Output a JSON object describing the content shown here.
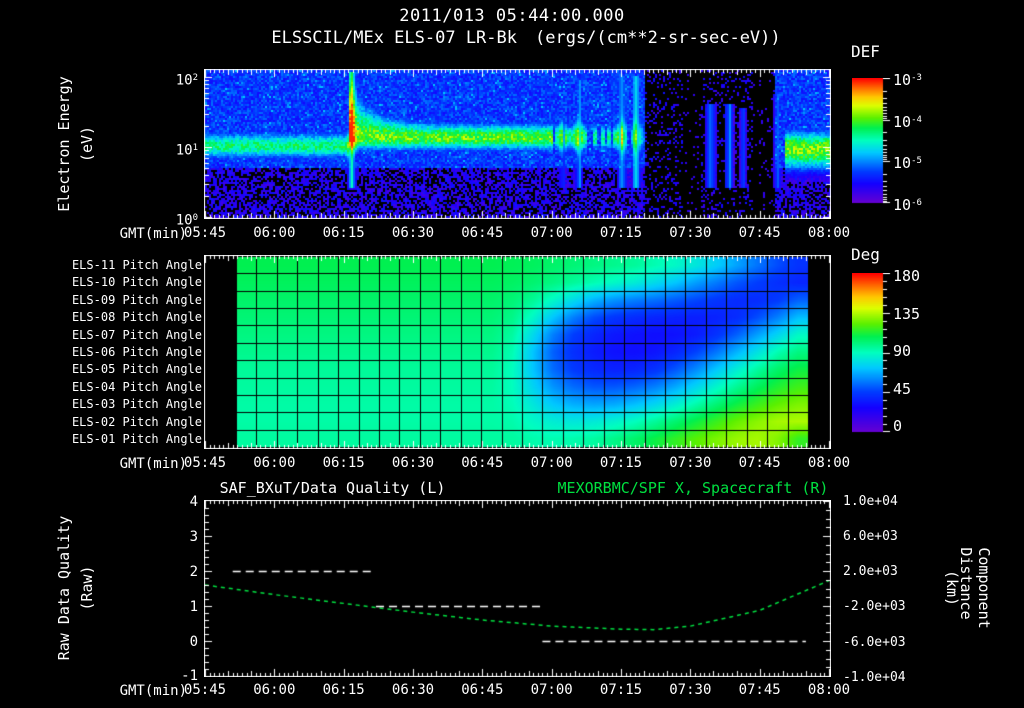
{
  "header": {
    "timestamp": "2011/013 05:44:00.000",
    "instrument_title": "ELSSCIL/MEx ELS-07 LR-Bk",
    "units": "(ergs/(cm**2-sr-sec-eV))"
  },
  "time_axis": {
    "label": "GMT(min)",
    "ticks": [
      "05:45",
      "06:00",
      "06:15",
      "06:30",
      "06:45",
      "07:00",
      "07:15",
      "07:30",
      "07:45",
      "08:00"
    ]
  },
  "spectrogram_panel": {
    "ylabel": "Electron Energy",
    "ylabel_units": "(eV)",
    "yticks": [
      {
        "base": "10",
        "exp": "2"
      },
      {
        "base": "10",
        "exp": "1"
      },
      {
        "base": "10",
        "exp": "0"
      }
    ],
    "colorbar": {
      "title": "DEF",
      "ticks": [
        {
          "base": "10",
          "exp": "-3"
        },
        {
          "base": "10",
          "exp": "-4"
        },
        {
          "base": "10",
          "exp": "-5"
        },
        {
          "base": "10",
          "exp": "-6"
        }
      ]
    }
  },
  "pitch_panel": {
    "row_labels": [
      "ELS-11 Pitch Angle",
      "ELS-10 Pitch Angle",
      "ELS-09 Pitch Angle",
      "ELS-08 Pitch Angle",
      "ELS-07 Pitch Angle",
      "ELS-06 Pitch Angle",
      "ELS-05 Pitch Angle",
      "ELS-04 Pitch Angle",
      "ELS-03 Pitch Angle",
      "ELS-02 Pitch Angle",
      "ELS-01 Pitch Angle"
    ],
    "colorbar": {
      "title": "Deg",
      "ticks": [
        "180",
        "135",
        "90",
        "45",
        "0"
      ]
    }
  },
  "quality_panel": {
    "title_left": "SAF_BXuT/Data Quality (L)",
    "title_right": "MEXORBMC/SPF X, Spacecraft (R)",
    "ylabel_left": "Raw Data Quality",
    "ylabel_left_units": "(Raw)",
    "ylabel_right": "Component Distance",
    "ylabel_right_units": "(km)",
    "yticks_left": [
      "4",
      "3",
      "2",
      "1",
      "0",
      "-1"
    ],
    "yticks_right": [
      "1.0e+04",
      "6.0e+03",
      "2.0e+03",
      "-2.0e+03",
      "-6.0e+03",
      "-1.0e+04"
    ]
  },
  "colors": {
    "text": "#ffffff",
    "accent_green": "#00e040",
    "background": "#000000"
  },
  "chart_data": [
    {
      "type": "heatmap",
      "title": "ELSSCIL/MEx ELS-07 LR-Bk electron differential energy flux spectrogram",
      "x_range_gmt": [
        "05:45",
        "08:00"
      ],
      "y_axis": {
        "label": "Electron Energy (eV)",
        "scale": "log",
        "range": [
          1,
          130
        ]
      },
      "z_axis": {
        "label": "DEF (ergs/(cm**2-sr-sec-eV))",
        "scale": "log",
        "range": [
          1e-06,
          0.001
        ]
      },
      "render": {
        "seed": 77,
        "band": {
          "center_log": 1.04,
          "sigma_up": 0.2,
          "sigma_dn": 0.18
        },
        "band_intensity": [
          [
            0,
            31,
            0.56
          ],
          [
            31,
            75,
            0.68
          ],
          [
            75,
            90,
            0.55
          ],
          [
            90,
            95,
            0.32
          ],
          [
            95,
            125,
            0
          ],
          [
            125,
            135.5,
            0.7
          ]
        ],
        "flare": {
          "t_min": 31,
          "decay": 5,
          "extra_sigma": 0.55
        },
        "post_flare_center": 1.16,
        "blob": {
          "t_min": 125,
          "center": 1.0,
          "sigma_up": 0.26,
          "sigma_dn": 0.3
        },
        "streaks": [
          [
            31.5,
            0.8,
            0.5,
            2.1
          ],
          [
            77,
            0.7,
            0.3,
            1.9
          ],
          [
            80.5,
            0.8,
            0.42,
            2.0
          ],
          [
            90,
            0.9,
            0.45,
            2.05
          ],
          [
            93,
            0.9,
            0.5,
            2.05
          ],
          [
            109,
            1.0,
            0.42,
            1.65
          ],
          [
            113,
            0.8,
            0.4,
            1.65
          ],
          [
            116,
            0.6,
            0.34,
            1.6
          ],
          [
            123.5,
            0.8,
            0.3,
            1.7
          ]
        ],
        "dark_zone": [
          95,
          123
        ],
        "black_columns": [
          [
            103,
            107
          ],
          [
            118,
            122.5
          ]
        ],
        "lower_split_log": 0.72
      }
    },
    {
      "type": "heatmap",
      "title": "ELS anode pitch angles",
      "units": "degrees",
      "rows": [
        "ELS-11",
        "ELS-10",
        "ELS-09",
        "ELS-08",
        "ELS-07",
        "ELS-06",
        "ELS-05",
        "ELS-04",
        "ELS-03",
        "ELS-02",
        "ELS-01"
      ],
      "col_start_gmt": "05:52",
      "col_end_gmt": "07:56",
      "n_cols": 28,
      "z_range": [
        0,
        180
      ],
      "values": [
        [
          108,
          108,
          108,
          108,
          108,
          108,
          108,
          108,
          108,
          108,
          108,
          108,
          108,
          107,
          106,
          104,
          102,
          100,
          98,
          96,
          92,
          88,
          82,
          74,
          65,
          56,
          48,
          42
        ],
        [
          106,
          106,
          106,
          106,
          106,
          106,
          106,
          106,
          106,
          106,
          106,
          106,
          106,
          105,
          103,
          100,
          96,
          92,
          88,
          84,
          78,
          72,
          64,
          57,
          50,
          45,
          41,
          38
        ],
        [
          104,
          104,
          104,
          104,
          104,
          104,
          104,
          104,
          104,
          104,
          104,
          104,
          104,
          102,
          97,
          88,
          78,
          68,
          62,
          58,
          55,
          51,
          47,
          43,
          40,
          40,
          44,
          52
        ],
        [
          102,
          102,
          102,
          102,
          102,
          102,
          102,
          102,
          102,
          102,
          102,
          102,
          102,
          99,
          88,
          72,
          58,
          48,
          43,
          40,
          38,
          37,
          36,
          37,
          40,
          48,
          58,
          70
        ],
        [
          100,
          100,
          100,
          100,
          100,
          100,
          100,
          100,
          100,
          100,
          100,
          100,
          100,
          95,
          78,
          58,
          45,
          38,
          34,
          32,
          31,
          32,
          35,
          42,
          52,
          64,
          76,
          88
        ],
        [
          98,
          98,
          98,
          98,
          98,
          98,
          98,
          98,
          98,
          98,
          98,
          98,
          98,
          92,
          72,
          52,
          41,
          35,
          32,
          31,
          33,
          38,
          46,
          56,
          68,
          80,
          92,
          100
        ],
        [
          96,
          96,
          96,
          96,
          96,
          96,
          96,
          96,
          96,
          96,
          96,
          96,
          96,
          90,
          72,
          54,
          44,
          39,
          37,
          38,
          42,
          50,
          60,
          72,
          84,
          95,
          104,
          110
        ],
        [
          95,
          95,
          95,
          95,
          95,
          95,
          95,
          95,
          95,
          95,
          95,
          95,
          95,
          90,
          76,
          62,
          54,
          50,
          50,
          53,
          58,
          66,
          76,
          87,
          97,
          106,
          113,
          118
        ],
        [
          94,
          94,
          94,
          94,
          94,
          94,
          94,
          94,
          94,
          94,
          94,
          94,
          94,
          91,
          82,
          72,
          67,
          65,
          66,
          70,
          76,
          84,
          93,
          102,
          110,
          117,
          123,
          127
        ],
        [
          94,
          94,
          94,
          94,
          94,
          94,
          94,
          94,
          94,
          94,
          94,
          94,
          94,
          93,
          88,
          84,
          82,
          83,
          86,
          90,
          96,
          103,
          110,
          117,
          124,
          129,
          133,
          134
        ],
        [
          95,
          95,
          95,
          95,
          95,
          95,
          95,
          95,
          95,
          95,
          95,
          95,
          95,
          95,
          93,
          92,
          93,
          95,
          99,
          104,
          110,
          116,
          122,
          127,
          131,
          133,
          128,
          116
        ]
      ]
    },
    {
      "type": "line",
      "title": "SAF_BXuT/Data Quality (L) and MEXORBMC/SPF X Spacecraft (R)",
      "left_axis": {
        "label": "Raw Data Quality (Raw)",
        "range": [
          -1,
          4
        ]
      },
      "right_axis": {
        "label": "Component Distance (km)",
        "range": [
          -10000,
          10000
        ]
      },
      "series": [
        {
          "name": "SAF_BXuT/Data Quality",
          "axis": "left",
          "style": "dashed-white",
          "segments": [
            {
              "gmt": [
                "05:51",
                "06:21"
              ],
              "value": 2
            },
            {
              "gmt": [
                "06:22",
                "06:58"
              ],
              "value": 1
            },
            {
              "gmt": [
                "06:58",
                "07:55"
              ],
              "value": 0
            }
          ]
        },
        {
          "name": "MEXORBMC/SPF X, Spacecraft",
          "axis": "right",
          "style": "dashed-green",
          "points": [
            [
              "05:45",
              400
            ],
            [
              "06:00",
              -700
            ],
            [
              "06:15",
              -1700
            ],
            [
              "06:30",
              -2700
            ],
            [
              "06:45",
              -3600
            ],
            [
              "07:00",
              -4300
            ],
            [
              "07:15",
              -4650
            ],
            [
              "07:22",
              -4700
            ],
            [
              "07:30",
              -4300
            ],
            [
              "07:45",
              -2500
            ],
            [
              "08:00",
              900
            ]
          ]
        }
      ]
    }
  ]
}
